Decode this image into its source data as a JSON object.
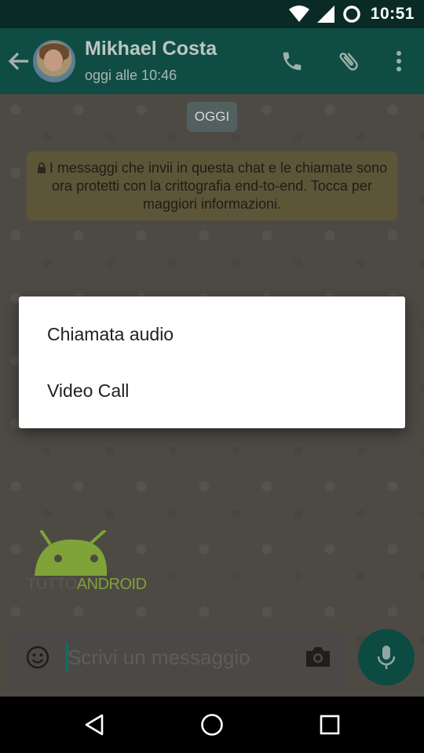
{
  "status_bar": {
    "time": "10:51"
  },
  "app_bar": {
    "contact_name": "Mikhael Costa",
    "last_seen": "oggi alle 10:46",
    "icons": [
      "back-arrow-icon",
      "phone-icon",
      "attach-icon",
      "more-vert-icon"
    ]
  },
  "chat": {
    "date_label": "OGGI",
    "encryption_notice": "I messaggi che invii in questa chat e le chiamate sono ora protetti con la crittografia end-to-end. Tocca per maggiori informazioni."
  },
  "watermark": {
    "part1": "TUTTO",
    "part2": "ANDROID"
  },
  "composer": {
    "placeholder": "Scrivi un messaggio"
  },
  "dialog": {
    "items": [
      {
        "label": "Chiamata audio"
      },
      {
        "label": "Video Call"
      }
    ]
  },
  "colors": {
    "app_bar": "#0f4d44",
    "status_bar": "#0a2a25",
    "dialog_bg": "#ffffff",
    "mic_button": "#0c4b42"
  }
}
